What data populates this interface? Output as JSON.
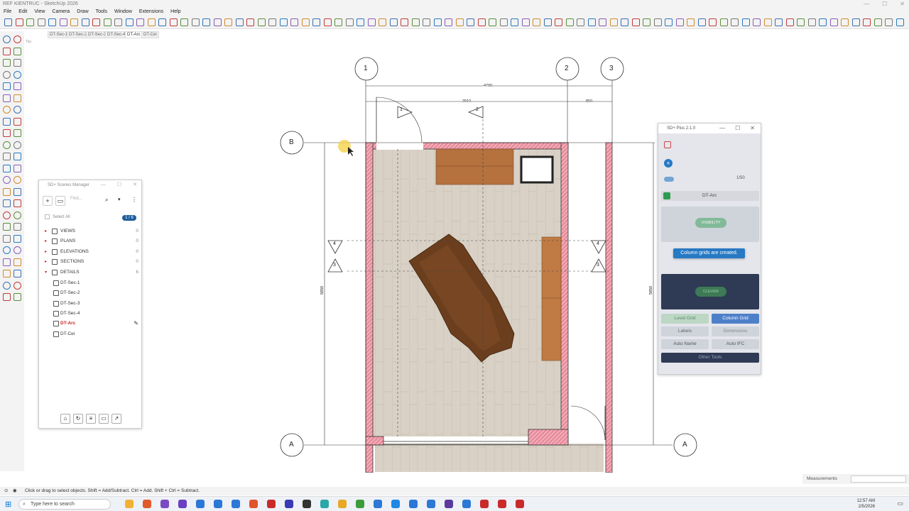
{
  "app": {
    "title": "REF KIENTRUC - SketchUp 2026",
    "menu": [
      "File",
      "Edit",
      "View",
      "Camera",
      "Draw",
      "Tools",
      "Window",
      "Extensions",
      "Help"
    ]
  },
  "scene_tabs": [
    "DT-Sec-1",
    "DT-Sec-2",
    "DT-Sec-3",
    "DT-Sec-4",
    "DT-Arc",
    "DT-Cei"
  ],
  "active_tab": "DT-Arc",
  "view_label": "Top",
  "drawing": {
    "grid_labels_top": [
      "1",
      "2",
      "3"
    ],
    "grid_labels_side": [
      "B",
      "A"
    ],
    "dims": {
      "overall": "4760",
      "inner": "3910",
      "right": "850",
      "height": "5850"
    },
    "section_marks": [
      "1",
      "2",
      "4",
      "3"
    ]
  },
  "scenes_manager": {
    "title": "SD+ Scenes Manager",
    "find_placeholder": "Find...",
    "select_all": "Select All",
    "count": "1 / 6",
    "groups": [
      {
        "label": "VIEWS",
        "count": "0"
      },
      {
        "label": "PLANS",
        "count": "0"
      },
      {
        "label": "ELEVATIONS",
        "count": "0"
      },
      {
        "label": "SECTIONS",
        "count": "0"
      },
      {
        "label": "DETAILS",
        "count": "6"
      }
    ],
    "details": [
      "DT-Sec-1",
      "DT-Sec-2",
      "DT-Sec-3",
      "DT-Sec-4",
      "DT-Arc",
      "DT-Cei"
    ],
    "selected": "DT-Arc"
  },
  "sdplus": {
    "title": "SD+ Plus 2.1.0",
    "scene_name": "DT-Arc",
    "scale": "1/50",
    "visibility": "VISIBILITY",
    "create_label": "CLEVER",
    "buttons": [
      "Level Grid",
      "Column Grid",
      "Labels",
      "Dimensions",
      "Auto Name",
      "Auto IFC",
      "Other Tools"
    ],
    "toast": "Column grids are created."
  },
  "status": {
    "hint": "Click or drag to select objects. Shift = Add/Subtract. Ctrl = Add. Shift + Ctrl = Subtract.",
    "measurements_label": "Measurements"
  },
  "taskbar": {
    "search_placeholder": "Type here to search",
    "time": "12:57 AM",
    "date": "2/5/2026"
  },
  "colors": {
    "accent": "#1e5e9c",
    "wall": "#e57a8c",
    "floor": "#d8d0c4",
    "toast": "#2779c4"
  }
}
